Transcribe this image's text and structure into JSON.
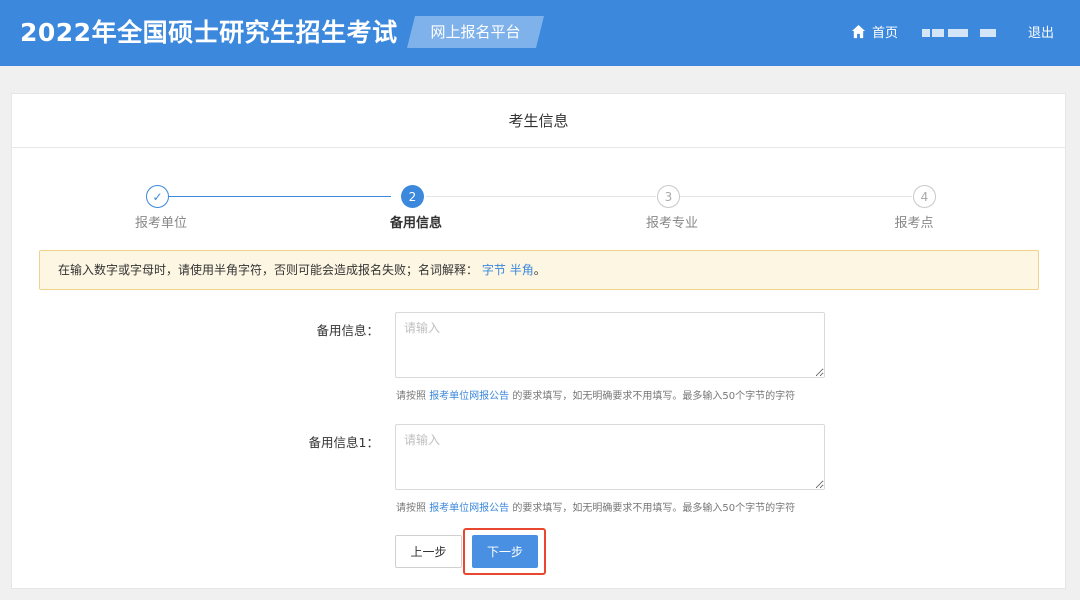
{
  "header": {
    "title": "2022年全国硕士研究生招生考试",
    "platform_label": "网上报名平台",
    "home_label": "首页",
    "logout_label": "退出",
    "background_color": "#3b88dc"
  },
  "page_title": "考生信息",
  "steps": [
    {
      "marker": "✓",
      "label": "报考单位",
      "state": "done"
    },
    {
      "marker": "2",
      "label": "备用信息",
      "state": "active"
    },
    {
      "marker": "3",
      "label": "报考专业",
      "state": "todo"
    },
    {
      "marker": "4",
      "label": "报考点",
      "state": "todo"
    }
  ],
  "notice": {
    "text": "在输入数字或字母时，请使用半角字符，否则可能会造成报名失败；名词解释：",
    "link1": "字节",
    "link2": "半角",
    "suffix": "。"
  },
  "fields": [
    {
      "label": "备用信息：",
      "placeholder": "请输入",
      "value": "",
      "hint_prefix": "请按照",
      "hint_link": "报考单位网报公告",
      "hint_suffix": "的要求填写，如无明确要求不用填写。最多输入50个字节的字符"
    },
    {
      "label": "备用信息1：",
      "placeholder": "请输入",
      "value": "",
      "hint_prefix": "请按照",
      "hint_link": "报考单位网报公告",
      "hint_suffix": "的要求填写，如无明确要求不用填写。最多输入50个字节的字符"
    }
  ],
  "buttons": {
    "prev": "上一步",
    "next": "下一步"
  },
  "colors": {
    "accent": "#3b88dc",
    "next_button": "#4a90e2",
    "highlight_border": "#e8462f",
    "notice_bg": "#fdf6e3"
  }
}
